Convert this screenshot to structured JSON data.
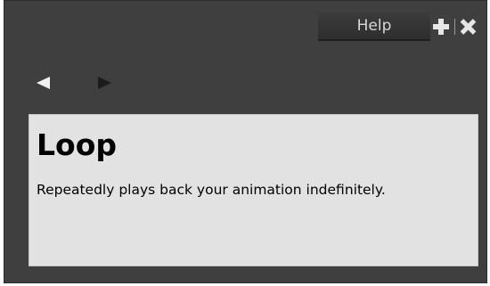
{
  "header": {
    "help_tab_label": "Help"
  },
  "icons": {
    "add": "plus-icon",
    "close": "close-icon",
    "back": "triangle-left-icon",
    "forward": "triangle-right-icon"
  },
  "content": {
    "title": "Loop",
    "description": "Repeatedly plays back your animation indefinitely."
  },
  "colors": {
    "panel_background": "#3f3f3f",
    "content_background": "#e2e2e2",
    "tab_text": "#d8d8d8"
  }
}
